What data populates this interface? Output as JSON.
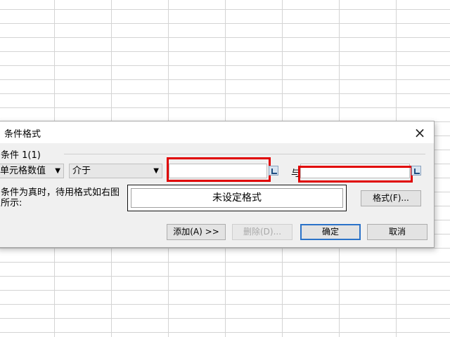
{
  "dialog": {
    "title": "条件格式",
    "close_glyph": "×",
    "condition_group_label": "条件 1(1)",
    "type_select_value": "单元格数值",
    "operator_select_value": "介于",
    "and_label": "与",
    "value1": "",
    "value2": "",
    "condition_description": "条件为真时，待用格式如右图所示:",
    "preview_text": "未设定格式",
    "format_button": "格式(F)...",
    "add_button": "添加(A) >>",
    "delete_button": "删除(D)...",
    "ok_button": "确定",
    "cancel_button": "取消",
    "dropdown_arrow": "▼"
  },
  "colors": {
    "highlight": "#e00000",
    "primary_border": "#2a72c8",
    "dialog_bg": "#f0f0f0"
  }
}
